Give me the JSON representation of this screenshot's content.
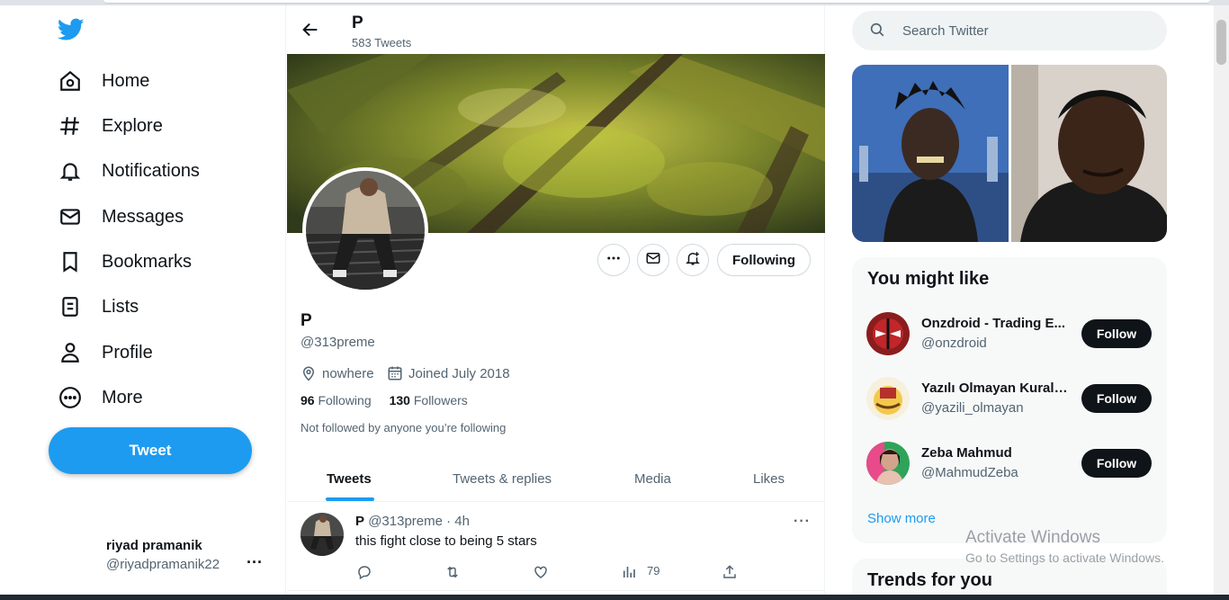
{
  "nav": {
    "items": [
      {
        "label": "Home",
        "icon": "home-icon"
      },
      {
        "label": "Explore",
        "icon": "hashtag-icon"
      },
      {
        "label": "Notifications",
        "icon": "bell-icon"
      },
      {
        "label": "Messages",
        "icon": "envelope-icon"
      },
      {
        "label": "Bookmarks",
        "icon": "bookmark-icon"
      },
      {
        "label": "Lists",
        "icon": "list-icon"
      },
      {
        "label": "Profile",
        "icon": "person-icon"
      },
      {
        "label": "More",
        "icon": "more-circle-icon"
      }
    ],
    "tweet_button": "Tweet",
    "account": {
      "name": "riyad pramanik",
      "handle": "@riyadpramanik22",
      "more": "..."
    }
  },
  "profile": {
    "header_name": "P",
    "tweet_count": "583 Tweets",
    "name": "P",
    "handle": "@313preme",
    "location": "nowhere",
    "joined": "Joined July 2018",
    "following_count": "96",
    "following_label": "Following",
    "followers_count": "130",
    "followers_label": "Followers",
    "not_followed": "Not followed by anyone you’re following",
    "following_button": "Following"
  },
  "tabs": [
    {
      "label": "Tweets",
      "active": true
    },
    {
      "label": "Tweets & replies",
      "active": false
    },
    {
      "label": "Media",
      "active": false
    },
    {
      "label": "Likes",
      "active": false
    }
  ],
  "tweet": {
    "name": "P",
    "meta": "@313preme · 4h",
    "text": "this fight close to being 5 stars",
    "views": "79"
  },
  "search": {
    "placeholder": "Search Twitter"
  },
  "suggestions": {
    "title": "You might like",
    "items": [
      {
        "name": "Onzdroid - Trading E...",
        "handle": "@onzdroid",
        "button": "Follow"
      },
      {
        "name": "Yazılı Olmayan Kurallar",
        "handle": "@yazili_olmayan",
        "button": "Follow"
      },
      {
        "name": "Zeba Mahmud",
        "handle": "@MahmudZeba",
        "button": "Follow"
      }
    ],
    "show_more": "Show more"
  },
  "trends": {
    "title": "Trends for you"
  },
  "watermark": {
    "line1": "Activate Windows",
    "line2": "Go to Settings to activate Windows."
  },
  "colors": {
    "accent": "#1d9bf0",
    "text": "#0f1419",
    "secondary": "#536471"
  }
}
